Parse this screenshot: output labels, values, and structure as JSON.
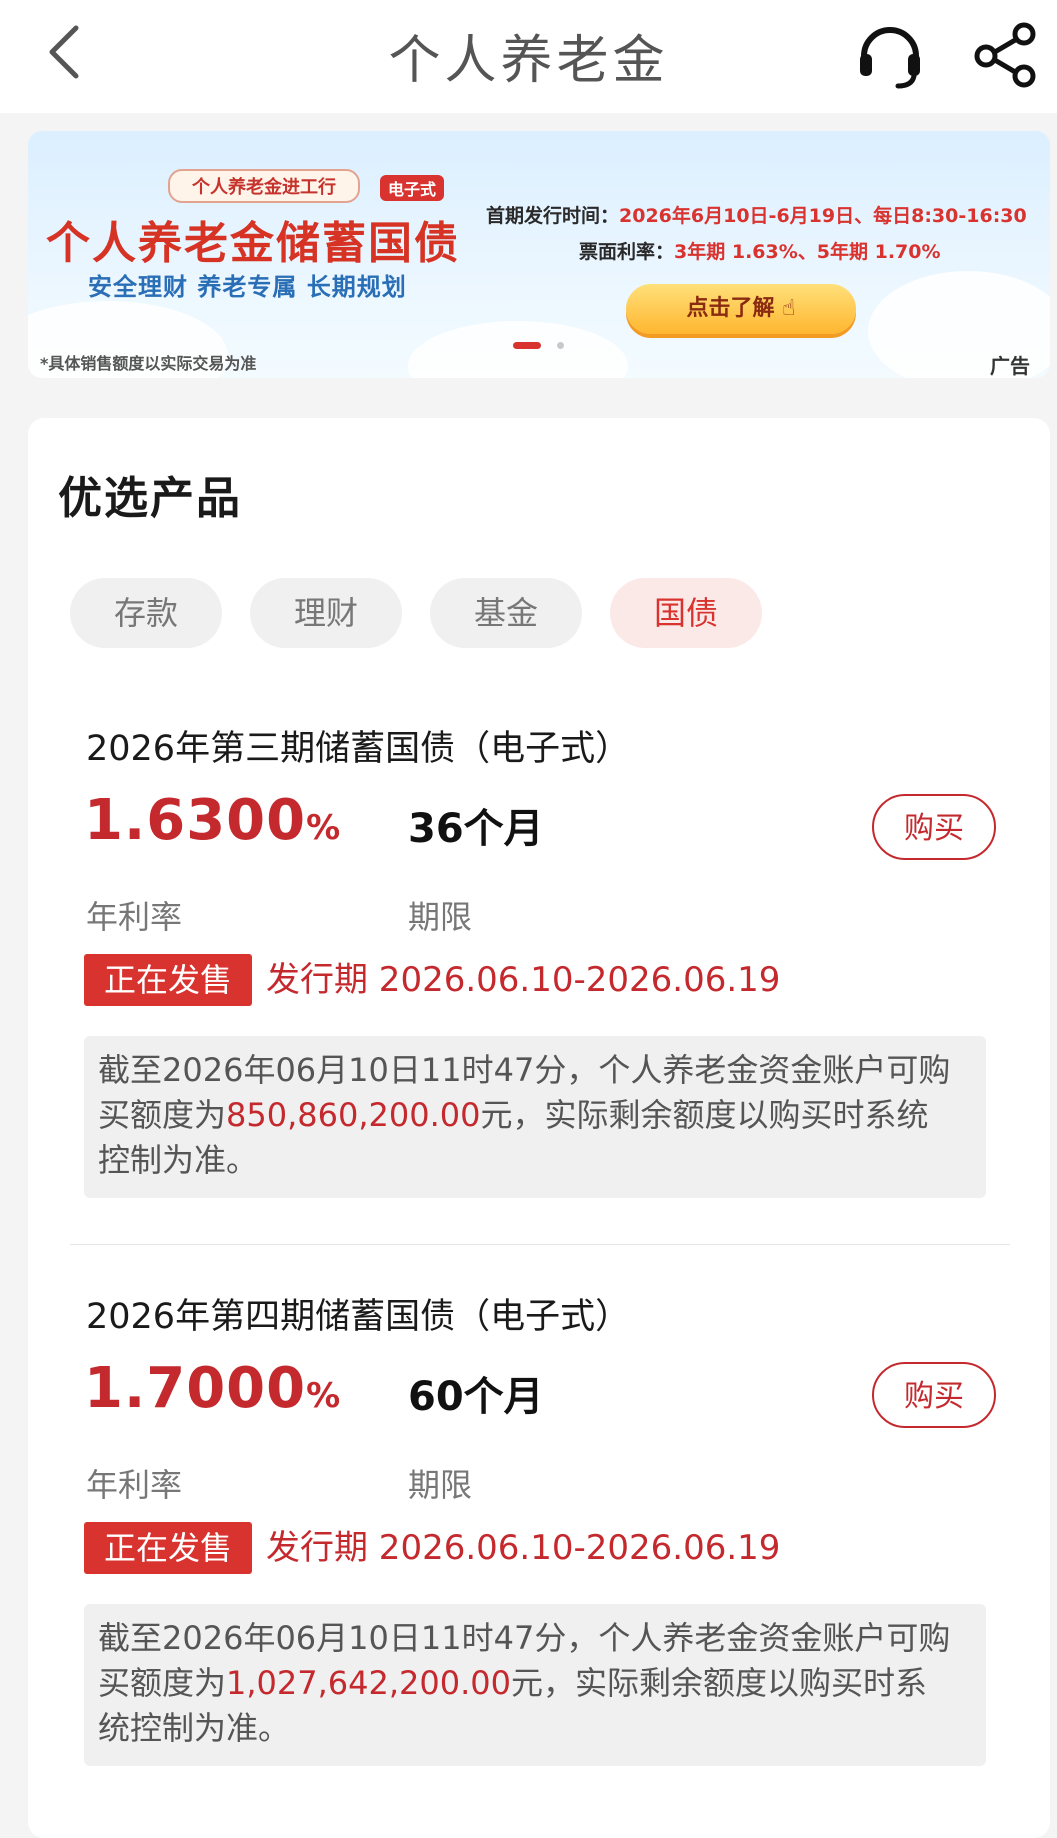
{
  "header": {
    "title": "个人养老金",
    "back_icon": "chevron-left-icon",
    "service_icon": "headset-icon",
    "share_icon": "share-icon"
  },
  "banner": {
    "tag_top": "个人养老金进工行",
    "tag_e": "电子式",
    "title": "个人养老金储蓄国债",
    "subtitle": "安全理财 养老专属 长期规划",
    "info_issue_label": "首期发行时间：",
    "info_issue_value": "2026年6月10日-6月19日、每日8:30-16:30",
    "info_rate_label": "票面利率：",
    "info_rate_value": "3年期 1.63%、5年期 1.70%",
    "button": "点击了解",
    "note": "*具体销售额度以实际交易为准",
    "ad": "广告"
  },
  "section": {
    "title": "优选产品",
    "tabs": [
      "存款",
      "理财",
      "基金",
      "国债"
    ],
    "active_tab": "国债"
  },
  "products": [
    {
      "name": "2026年第三期储蓄国债（电子式）",
      "rate": "1.6300",
      "rate_unit": "%",
      "term": "36个月",
      "rate_label": "年利率",
      "term_label": "期限",
      "buy": "购买",
      "status": "正在发售",
      "period": "发行期 2026.06.10-2026.06.19",
      "notice_line1": "截至2026年06月10日11时47分，个人养老金资金账户可购",
      "notice_pre": "买额度为",
      "notice_amount": "850,860,200.00",
      "notice_post": "元，实际剩余额度以购买时系统",
      "notice_line3": "控制为准。"
    },
    {
      "name": "2026年第四期储蓄国债（电子式）",
      "rate": "1.7000",
      "rate_unit": "%",
      "term": "60个月",
      "rate_label": "年利率",
      "term_label": "期限",
      "buy": "购买",
      "status": "正在发售",
      "period": "发行期 2026.06.10-2026.06.19",
      "notice_line1": "截至2026年06月10日11时47分，个人养老金资金账户可购",
      "notice_pre": "买额度为",
      "notice_amount": "1,027,642,200.00",
      "notice_post": "元，实际剩余额度以购买时系",
      "notice_line3": "统控制为准。"
    }
  ],
  "colors": {
    "accent": "#c4292e",
    "badge": "#d9332f",
    "background": "#f4f4f4"
  }
}
